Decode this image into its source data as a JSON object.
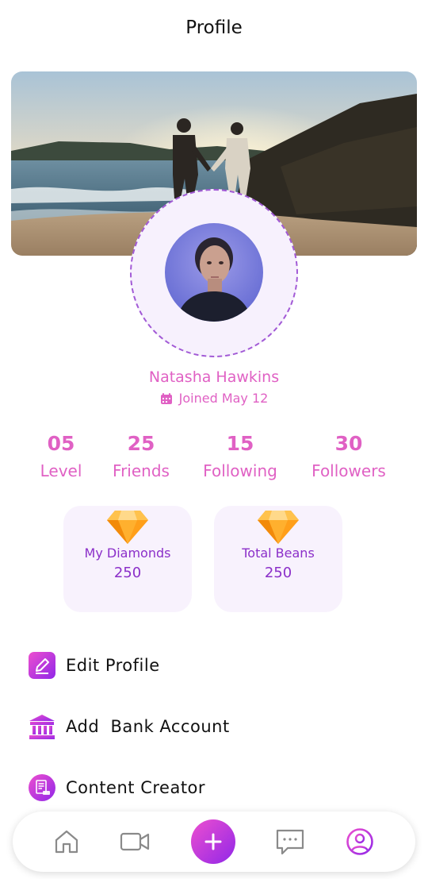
{
  "header": {
    "title": "Profile"
  },
  "profile": {
    "name": "Natasha Hawkins",
    "joined": "Joined May 12"
  },
  "stats": [
    {
      "value": "05",
      "label": "Level"
    },
    {
      "value": "25",
      "label": "Friends"
    },
    {
      "value": "15",
      "label": "Following"
    },
    {
      "value": "30",
      "label": "Followers"
    }
  ],
  "balances": [
    {
      "label": "My Diamonds",
      "value": "250",
      "icon": "diamond-icon"
    },
    {
      "label": "Total Beans",
      "value": "250",
      "icon": "diamond-icon"
    }
  ],
  "menu": [
    {
      "label": "Edit Profile",
      "icon": "edit-icon"
    },
    {
      "label": "Add  Bank Account",
      "icon": "bank-icon"
    },
    {
      "label": "Content Creator",
      "icon": "content-creator-icon"
    }
  ],
  "navbar": {
    "items": [
      "home-icon",
      "video-camera-icon",
      "add-icon",
      "chat-icon",
      "profile-icon"
    ],
    "active": "profile-icon"
  },
  "colors": {
    "accent_pink": "#e061c4",
    "accent_purple": "#8b2fc9",
    "card_bg": "#f8f2fd",
    "gradient_start": "#ed4fcf",
    "gradient_end": "#9127e8"
  }
}
